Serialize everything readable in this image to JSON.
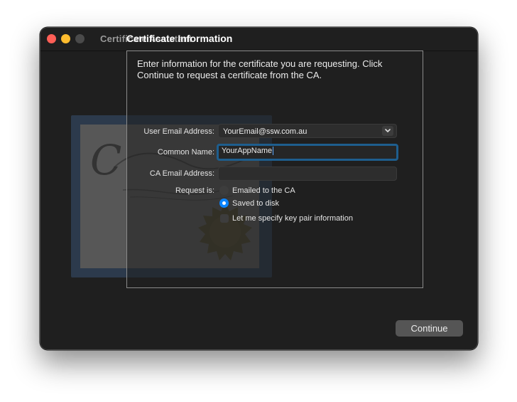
{
  "window": {
    "title": "Certificate Assistant"
  },
  "heading": "Certificate Information",
  "intro": "Enter information for the certificate you are requesting. Click Continue to request a certificate from the CA.",
  "form": {
    "user_email_label": "User Email Address:",
    "user_email_value": "YourEmail@ssw.com.au",
    "common_name_label": "Common Name:",
    "common_name_value": "YourAppName",
    "ca_email_label": "CA Email Address:",
    "ca_email_value": "",
    "request_label": "Request is:",
    "option_emailed": "Emailed to the CA",
    "option_saved": "Saved to disk",
    "selected_option": "Saved to disk",
    "key_pair_label": "Let me specify key pair information",
    "key_pair_checked": false
  },
  "buttons": {
    "continue": "Continue"
  },
  "colors": {
    "accent": "#0a84ff",
    "focus_ring": "#1e5e8e",
    "window_bg": "#1f1f1f",
    "close": "#ff5f57",
    "minimize": "#febc2e"
  },
  "icons": {
    "close": "close-dot",
    "minimize": "minimize-dot",
    "zoom": "zoom-dot",
    "dropdown": "chevron-down-icon"
  }
}
